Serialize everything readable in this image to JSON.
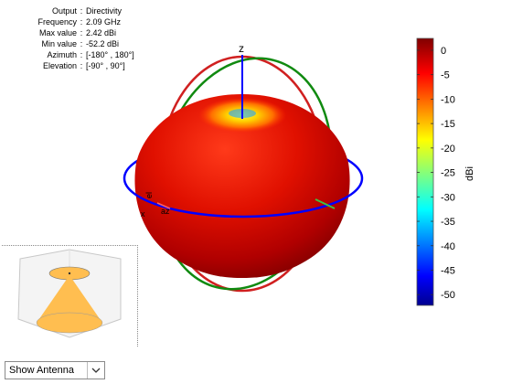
{
  "info": [
    {
      "key": "Output",
      "value": "Directivity"
    },
    {
      "key": "Frequency",
      "value": "2.09 GHz"
    },
    {
      "key": "Max value",
      "value": "2.42 dBi"
    },
    {
      "key": "Min value",
      "value": "-52.2 dBi"
    },
    {
      "key": "Azimuth",
      "value": "[-180° , 180°]"
    },
    {
      "key": "Elevation",
      "value": "[-90° , 90°]"
    }
  ],
  "info_separator": ":",
  "axes": {
    "z_label": "z",
    "y_label": "el",
    "x_label": "x",
    "az_label": "az"
  },
  "select": {
    "value": "Show Antenna"
  },
  "colors": {
    "azimuth_circle": "#0000ff",
    "elevation_circle_1": "#d02020",
    "elevation_circle_2": "#108a10",
    "z_axis": "#0000ff"
  },
  "chart_data": {
    "type": "heatmap",
    "title": "",
    "colorbar": {
      "label": "dBi",
      "ticks": [
        0,
        -5,
        -10,
        -15,
        -20,
        -25,
        -30,
        -35,
        -40,
        -45,
        -50
      ],
      "range": [
        -52.2,
        2.42
      ],
      "colormap": "jet"
    },
    "max_value_dbi": 2.42,
    "min_value_dbi": -52.2
  }
}
